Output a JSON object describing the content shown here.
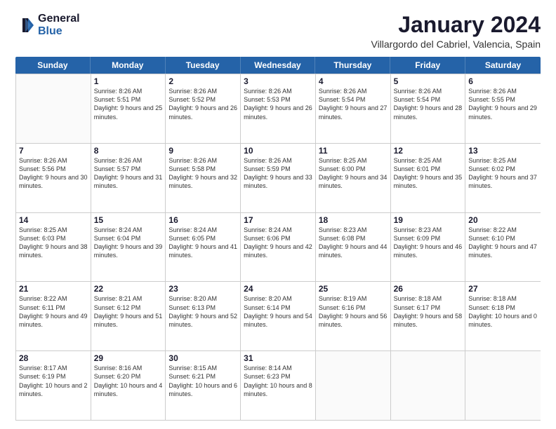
{
  "header": {
    "logo_line1": "General",
    "logo_line2": "Blue",
    "month_year": "January 2024",
    "location": "Villargordo del Cabriel, Valencia, Spain"
  },
  "weekdays": [
    "Sunday",
    "Monday",
    "Tuesday",
    "Wednesday",
    "Thursday",
    "Friday",
    "Saturday"
  ],
  "weeks": [
    [
      {
        "day": "",
        "empty": true
      },
      {
        "day": "1",
        "sunrise": "Sunrise: 8:26 AM",
        "sunset": "Sunset: 5:51 PM",
        "daylight": "Daylight: 9 hours and 25 minutes."
      },
      {
        "day": "2",
        "sunrise": "Sunrise: 8:26 AM",
        "sunset": "Sunset: 5:52 PM",
        "daylight": "Daylight: 9 hours and 26 minutes."
      },
      {
        "day": "3",
        "sunrise": "Sunrise: 8:26 AM",
        "sunset": "Sunset: 5:53 PM",
        "daylight": "Daylight: 9 hours and 26 minutes."
      },
      {
        "day": "4",
        "sunrise": "Sunrise: 8:26 AM",
        "sunset": "Sunset: 5:54 PM",
        "daylight": "Daylight: 9 hours and 27 minutes."
      },
      {
        "day": "5",
        "sunrise": "Sunrise: 8:26 AM",
        "sunset": "Sunset: 5:54 PM",
        "daylight": "Daylight: 9 hours and 28 minutes."
      },
      {
        "day": "6",
        "sunrise": "Sunrise: 8:26 AM",
        "sunset": "Sunset: 5:55 PM",
        "daylight": "Daylight: 9 hours and 29 minutes."
      }
    ],
    [
      {
        "day": "7",
        "sunrise": "Sunrise: 8:26 AM",
        "sunset": "Sunset: 5:56 PM",
        "daylight": "Daylight: 9 hours and 30 minutes."
      },
      {
        "day": "8",
        "sunrise": "Sunrise: 8:26 AM",
        "sunset": "Sunset: 5:57 PM",
        "daylight": "Daylight: 9 hours and 31 minutes."
      },
      {
        "day": "9",
        "sunrise": "Sunrise: 8:26 AM",
        "sunset": "Sunset: 5:58 PM",
        "daylight": "Daylight: 9 hours and 32 minutes."
      },
      {
        "day": "10",
        "sunrise": "Sunrise: 8:26 AM",
        "sunset": "Sunset: 5:59 PM",
        "daylight": "Daylight: 9 hours and 33 minutes."
      },
      {
        "day": "11",
        "sunrise": "Sunrise: 8:25 AM",
        "sunset": "Sunset: 6:00 PM",
        "daylight": "Daylight: 9 hours and 34 minutes."
      },
      {
        "day": "12",
        "sunrise": "Sunrise: 8:25 AM",
        "sunset": "Sunset: 6:01 PM",
        "daylight": "Daylight: 9 hours and 35 minutes."
      },
      {
        "day": "13",
        "sunrise": "Sunrise: 8:25 AM",
        "sunset": "Sunset: 6:02 PM",
        "daylight": "Daylight: 9 hours and 37 minutes."
      }
    ],
    [
      {
        "day": "14",
        "sunrise": "Sunrise: 8:25 AM",
        "sunset": "Sunset: 6:03 PM",
        "daylight": "Daylight: 9 hours and 38 minutes."
      },
      {
        "day": "15",
        "sunrise": "Sunrise: 8:24 AM",
        "sunset": "Sunset: 6:04 PM",
        "daylight": "Daylight: 9 hours and 39 minutes."
      },
      {
        "day": "16",
        "sunrise": "Sunrise: 8:24 AM",
        "sunset": "Sunset: 6:05 PM",
        "daylight": "Daylight: 9 hours and 41 minutes."
      },
      {
        "day": "17",
        "sunrise": "Sunrise: 8:24 AM",
        "sunset": "Sunset: 6:06 PM",
        "daylight": "Daylight: 9 hours and 42 minutes."
      },
      {
        "day": "18",
        "sunrise": "Sunrise: 8:23 AM",
        "sunset": "Sunset: 6:08 PM",
        "daylight": "Daylight: 9 hours and 44 minutes."
      },
      {
        "day": "19",
        "sunrise": "Sunrise: 8:23 AM",
        "sunset": "Sunset: 6:09 PM",
        "daylight": "Daylight: 9 hours and 46 minutes."
      },
      {
        "day": "20",
        "sunrise": "Sunrise: 8:22 AM",
        "sunset": "Sunset: 6:10 PM",
        "daylight": "Daylight: 9 hours and 47 minutes."
      }
    ],
    [
      {
        "day": "21",
        "sunrise": "Sunrise: 8:22 AM",
        "sunset": "Sunset: 6:11 PM",
        "daylight": "Daylight: 9 hours and 49 minutes."
      },
      {
        "day": "22",
        "sunrise": "Sunrise: 8:21 AM",
        "sunset": "Sunset: 6:12 PM",
        "daylight": "Daylight: 9 hours and 51 minutes."
      },
      {
        "day": "23",
        "sunrise": "Sunrise: 8:20 AM",
        "sunset": "Sunset: 6:13 PM",
        "daylight": "Daylight: 9 hours and 52 minutes."
      },
      {
        "day": "24",
        "sunrise": "Sunrise: 8:20 AM",
        "sunset": "Sunset: 6:14 PM",
        "daylight": "Daylight: 9 hours and 54 minutes."
      },
      {
        "day": "25",
        "sunrise": "Sunrise: 8:19 AM",
        "sunset": "Sunset: 6:16 PM",
        "daylight": "Daylight: 9 hours and 56 minutes."
      },
      {
        "day": "26",
        "sunrise": "Sunrise: 8:18 AM",
        "sunset": "Sunset: 6:17 PM",
        "daylight": "Daylight: 9 hours and 58 minutes."
      },
      {
        "day": "27",
        "sunrise": "Sunrise: 8:18 AM",
        "sunset": "Sunset: 6:18 PM",
        "daylight": "Daylight: 10 hours and 0 minutes."
      }
    ],
    [
      {
        "day": "28",
        "sunrise": "Sunrise: 8:17 AM",
        "sunset": "Sunset: 6:19 PM",
        "daylight": "Daylight: 10 hours and 2 minutes."
      },
      {
        "day": "29",
        "sunrise": "Sunrise: 8:16 AM",
        "sunset": "Sunset: 6:20 PM",
        "daylight": "Daylight: 10 hours and 4 minutes."
      },
      {
        "day": "30",
        "sunrise": "Sunrise: 8:15 AM",
        "sunset": "Sunset: 6:21 PM",
        "daylight": "Daylight: 10 hours and 6 minutes."
      },
      {
        "day": "31",
        "sunrise": "Sunrise: 8:14 AM",
        "sunset": "Sunset: 6:23 PM",
        "daylight": "Daylight: 10 hours and 8 minutes."
      },
      {
        "day": "",
        "empty": true
      },
      {
        "day": "",
        "empty": true
      },
      {
        "day": "",
        "empty": true
      }
    ]
  ]
}
